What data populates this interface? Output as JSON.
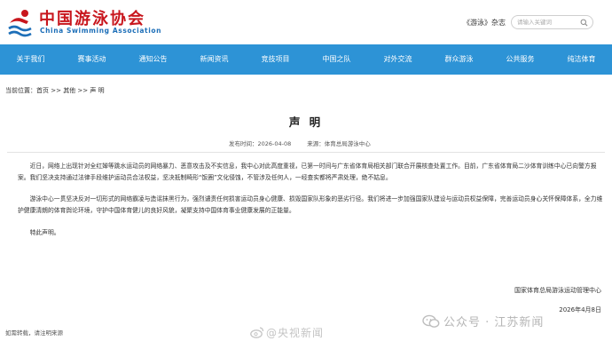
{
  "header": {
    "logo_cn": "中国游泳协会",
    "logo_en": "China Swimming Association",
    "magazine_link": "《游泳》杂志",
    "search_placeholder": "请输入关键词"
  },
  "nav": {
    "items": [
      "关于我们",
      "赛事活动",
      "通知公告",
      "新闻资讯",
      "竞技项目",
      "中国之队",
      "对外交流",
      "群众游泳",
      "公共服务",
      "纯洁体育"
    ]
  },
  "breadcrumb": {
    "prefix": "当前位置：",
    "home": "首页",
    "sep1": " >> ",
    "other": "其他",
    "sep2": " >> ",
    "current": "声 明"
  },
  "article": {
    "title": "声 明",
    "publish_label": "发布时间：",
    "publish_date": "2026-04-08",
    "source_label": "来源：",
    "source": "体育总局游泳中心",
    "paragraphs": [
      "近日，网络上出现针对全红婵等跳水运动员的网络暴力、恶意攻击及不实信息，我中心对此高度重视，已第一时间与广东省体育局相关部门联合开展核查处置工作。目前，广东省体育局二沙体育训练中心已向警方报案。我们坚决支持通过法律手段维护运动员合法权益，坚决抵制畸形“饭圈”文化侵蚀，不管涉及任何人，一经查实都将严肃处理，绝不姑息。",
      "游泳中心一贯坚决反对一切形式的网络霸凌与造谣抹黑行为，强烈谴责任何损害运动员身心健康、损毁国家队形象的恶劣行径。我们将进一步加强国家队建设与运动员权益保障，完善运动员身心关怀保障体系，全力维护健康清朗的体育舆论环境，守护中国体育健儿的良好风貌，凝聚支持中国体育事业健康发展的正能量。",
      "特此声明。"
    ],
    "signature_org": "国家体育总局游泳运动管理中心",
    "signature_date": "2026年4月8日"
  },
  "footer": {
    "reprint_note": "如需转载，请注明来源"
  },
  "watermarks": {
    "wechat": "公众号 · 江苏新闻",
    "weibo": "@央视新闻"
  },
  "colors": {
    "nav_bg": "#2d93d6",
    "brand_red": "#c8161d",
    "brand_blue": "#1d6fb8"
  }
}
